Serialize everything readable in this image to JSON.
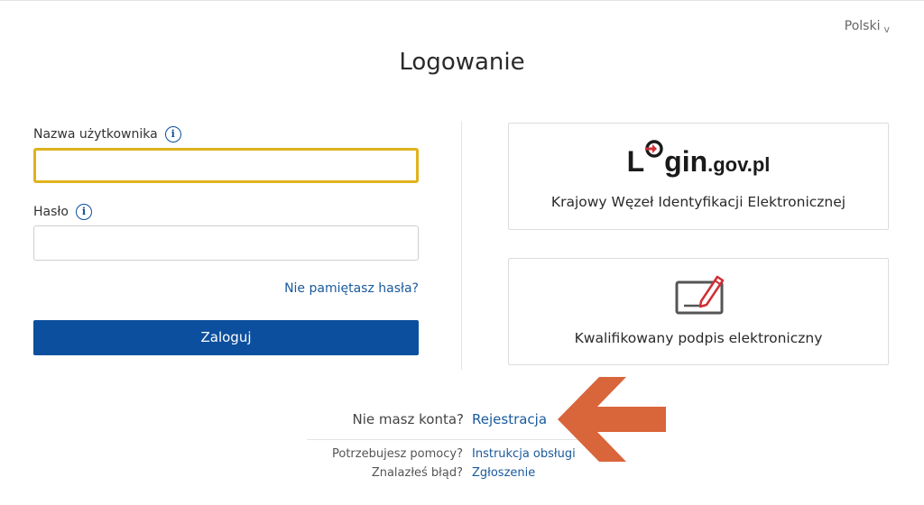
{
  "header": {
    "language": "Polski"
  },
  "page": {
    "title": "Logowanie"
  },
  "form": {
    "username_label": "Nazwa użytkownika",
    "username_value": "",
    "password_label": "Hasło",
    "password_value": "",
    "forgot_link": "Nie pamiętasz hasła?",
    "login_button": "Zaloguj"
  },
  "options": {
    "login_gov": {
      "logo_main": "Login",
      "logo_suffix": ".gov.pl",
      "label": "Krajowy Węzeł Identyfikacji Elektronicznej"
    },
    "qualified_signature": {
      "label": "Kwalifikowany podpis elektroniczny"
    }
  },
  "footer": {
    "no_account": "Nie masz konta?",
    "register": "Rejestracja",
    "need_help": "Potrzebujesz pomocy?",
    "manual": "Instrukcja obsługi",
    "found_bug": "Znalazłeś błąd?",
    "report": "Zgłoszenie"
  },
  "colors": {
    "primary": "#0c4f9e",
    "focus": "#e0b21d",
    "link": "#1a5a9c",
    "arrow": "#d9653b",
    "logo_accent": "#d12f35"
  }
}
